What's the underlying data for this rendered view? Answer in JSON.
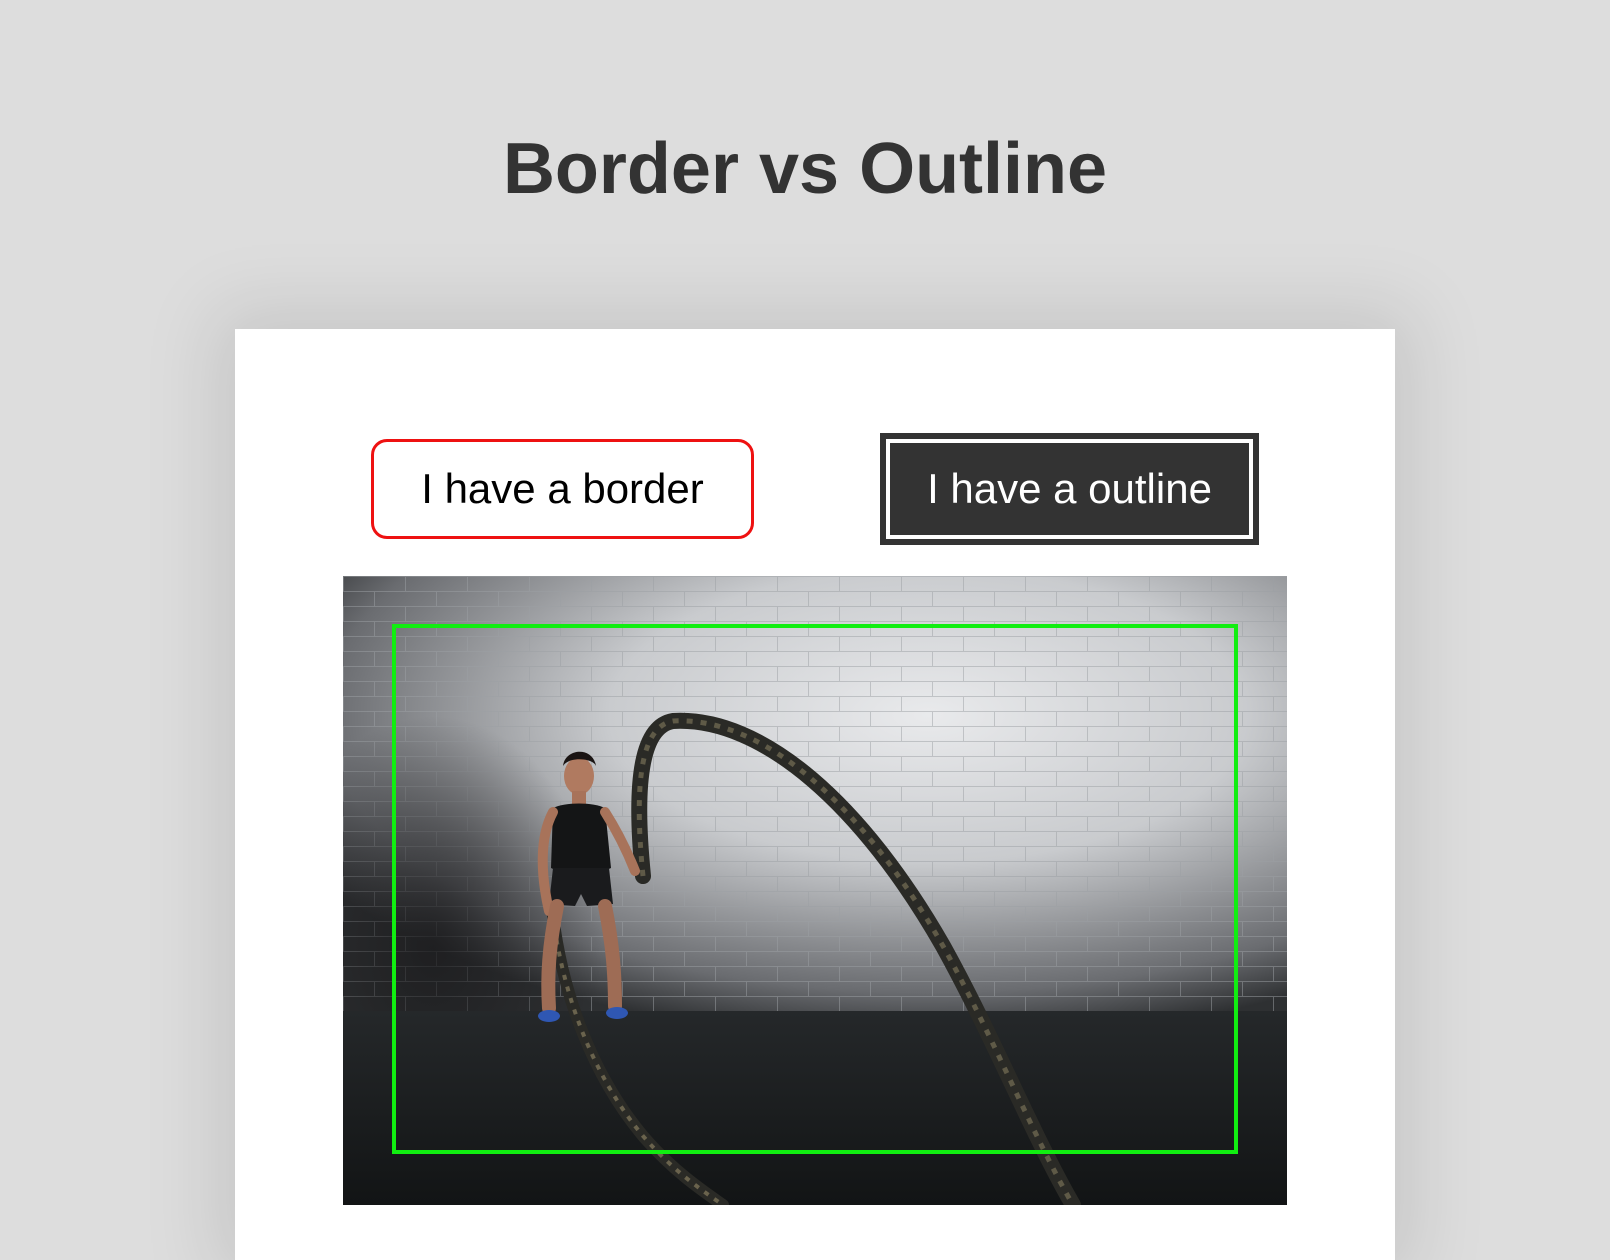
{
  "page": {
    "title": "Border vs Outline"
  },
  "buttons": {
    "border_label": "I have a border",
    "outline_label": "I have a outline"
  },
  "colors": {
    "background": "#dddddd",
    "title_text": "#333333",
    "card": "#ffffff",
    "border_button_border": "#ee1111",
    "outline_button_fill": "#333333",
    "photo_frame": "#11ee11"
  },
  "icons": {
    "photo": "battle-rope-workout-photo"
  }
}
